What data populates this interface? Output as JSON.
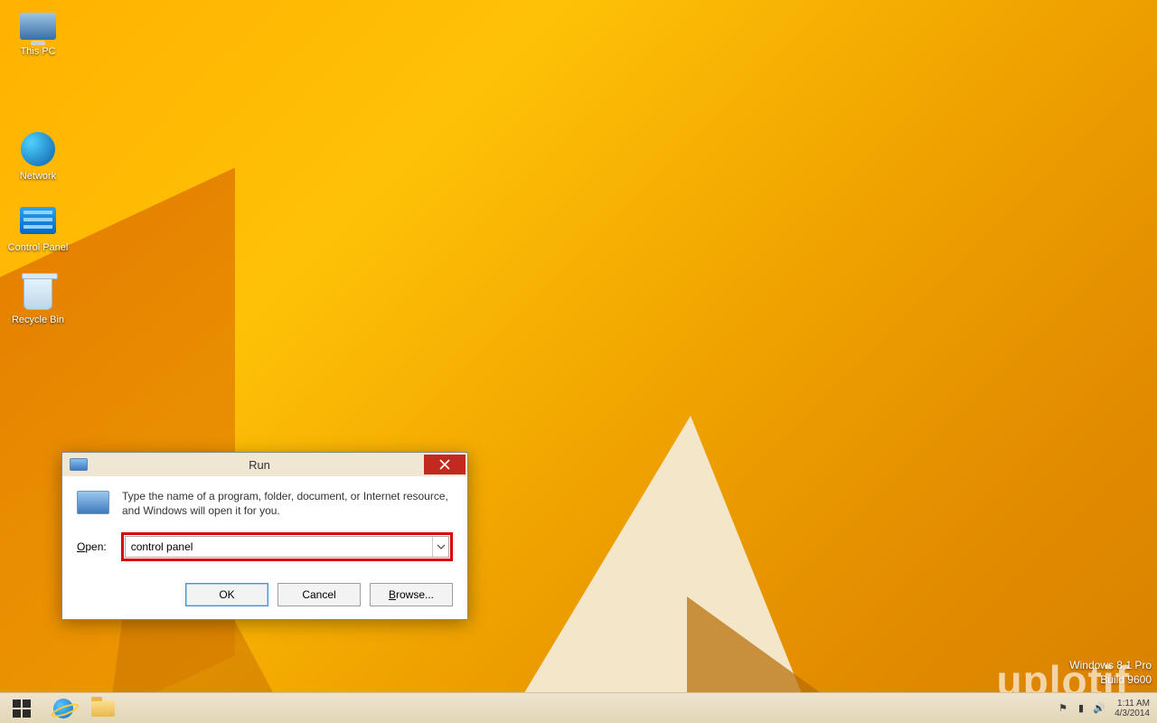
{
  "desktop": {
    "icons": [
      {
        "name": "this-pc",
        "label": "This PC"
      },
      {
        "name": "network",
        "label": "Network"
      },
      {
        "name": "control-panel",
        "label": "Control Panel"
      },
      {
        "name": "recycle-bin",
        "label": "Recycle Bin"
      }
    ]
  },
  "winver": {
    "line1": "Windows 8.1 Pro",
    "line2": "Build 9600"
  },
  "watermark": "uplotif",
  "run_dialog": {
    "title": "Run",
    "description": "Type the name of a program, folder, document, or Internet resource, and Windows will open it for you.",
    "open_label": "Open:",
    "open_access": "O",
    "input_value": "control panel",
    "buttons": {
      "ok": "OK",
      "cancel": "Cancel",
      "browse": "Browse...",
      "browse_access": "B"
    }
  },
  "taskbar": {
    "time": "1:11 AM",
    "date": "4/3/2014"
  }
}
